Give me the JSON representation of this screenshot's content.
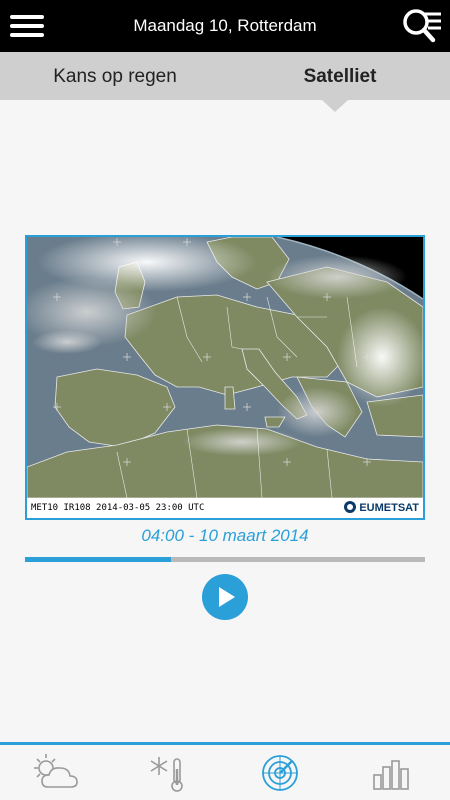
{
  "header": {
    "title": "Maandag 10, Rotterdam",
    "menu_icon": "hamburger-menu-icon",
    "search_icon": "search-list-icon"
  },
  "tabs": [
    {
      "label": "Kans op regen",
      "active": false
    },
    {
      "label": "Satelliet",
      "active": true
    }
  ],
  "satellite": {
    "caption": "MET10 IR108 2014-03-05 23:00 UTC",
    "logo_text": "EUMETSAT"
  },
  "timestamp": "04:00 - 10 maart 2014",
  "progress": {
    "fraction": 0.365
  },
  "play_icon": "play-icon",
  "bottom_nav": [
    {
      "icon": "partly-cloudy-weather-icon",
      "active": false
    },
    {
      "icon": "snow-thermometer-icon",
      "active": false
    },
    {
      "icon": "radar-icon",
      "active": true
    },
    {
      "icon": "bar-chart-icon",
      "active": false
    }
  ],
  "colors": {
    "accent": "#2a9fd8",
    "header_bg": "#000000",
    "tab_bg": "#cfcfcf",
    "inactive_icon": "#9a9a9a"
  }
}
